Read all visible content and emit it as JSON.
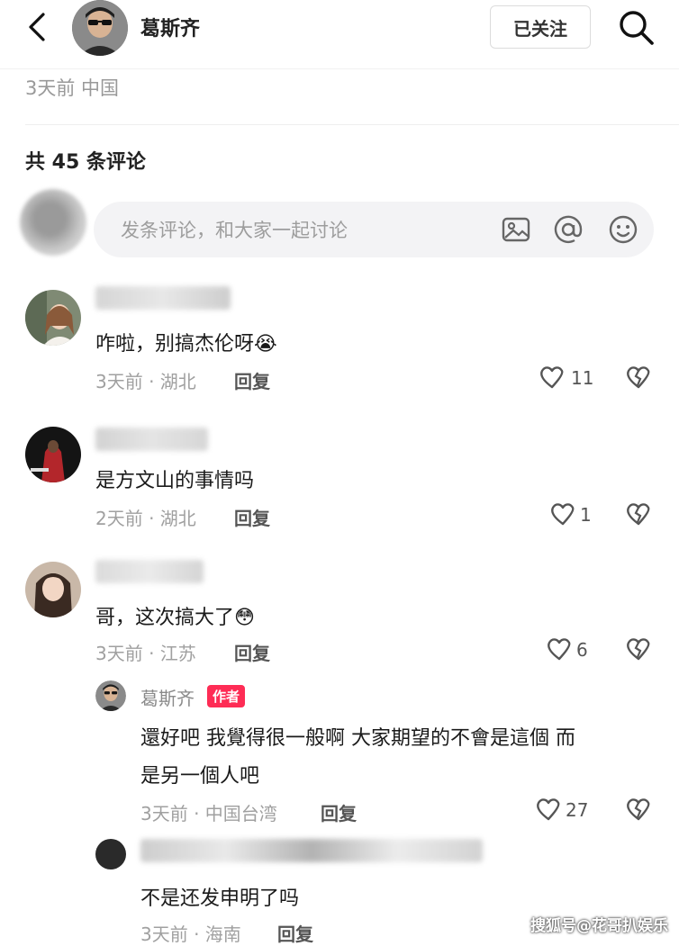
{
  "header": {
    "user_name": "葛斯齐",
    "follow_label": "已关注",
    "back_icon": "chevron-left-icon",
    "search_icon": "search-icon"
  },
  "post_meta": "3天前 中国",
  "comments_count": "共 45 条评论",
  "comment_input": {
    "placeholder": "发条评论，和大家一起讨论",
    "icons": [
      "image-icon",
      "at-icon",
      "emoji-icon"
    ]
  },
  "comments": [
    {
      "text": "咋啦，别搞杰伦呀",
      "emoji": "😭",
      "meta": "3天前 · 湖北",
      "reply": "回复",
      "likes": "11"
    },
    {
      "text": "是方文山的事情吗",
      "meta": "2天前 · 湖北",
      "reply": "回复",
      "likes": "1"
    },
    {
      "text": "哥，这次搞大了",
      "emoji": "😳",
      "meta": "3天前 · 江苏",
      "reply": "回复",
      "likes": "6",
      "replies": [
        {
          "name": "葛斯齐",
          "badge": "作者",
          "text_line1": "還好吧 我覺得很一般啊 大家期望的不會是這個 而",
          "text_line2": "是另一個人吧",
          "meta": "3天前 · 中国台湾",
          "reply": "回复",
          "likes": "27"
        },
        {
          "text": "不是还发申明了吗",
          "meta": "3天前 · 海南",
          "reply": "回复"
        }
      ]
    }
  ],
  "watermark": "搜狐号@花哥扒娱乐"
}
